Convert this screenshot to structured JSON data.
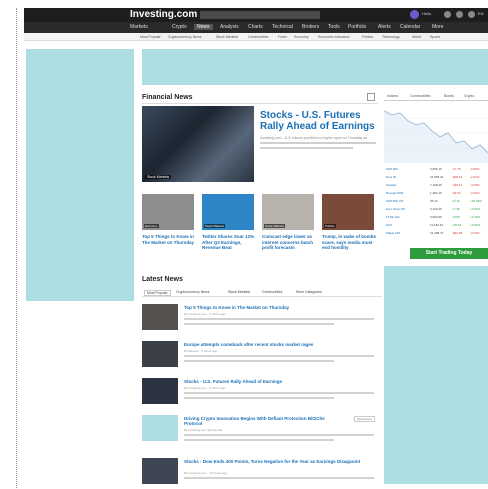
{
  "header": {
    "logo": "Investing.com",
    "search_placeholder": "Search the website...",
    "user_label": "Hello",
    "language": "EN"
  },
  "nav": {
    "items": [
      "Markets",
      "Crypto",
      "News",
      "Analysis",
      "Charts",
      "Technical",
      "Brokers",
      "Tools",
      "Portfolio",
      "Alerts",
      "Calendar",
      "More"
    ]
  },
  "subnav": {
    "items": [
      "Most Popular",
      "Cryptocurrency News",
      "Stock Markets",
      "Commodities",
      "Forex",
      "Economy",
      "Economic Indicators",
      "Politics",
      "Technology",
      "World",
      "Sports"
    ]
  },
  "financial_news": {
    "title": "Financial News",
    "main_story": {
      "tag": "Stock Markets",
      "headline": "Stocks - U.S. Futures Rally Ahead of Earnings",
      "meta": "Investing.com - U.S. futures pointed to a higher open on Thursday as…"
    },
    "thumbs": [
      {
        "tag": "Economy",
        "caption": "Top 5 Things to Know in The Market on Thursday",
        "color": "#8d8d8d"
      },
      {
        "tag": "Stock Markets",
        "caption": "Twitter Shares Soar 12% After Q3 Earnings, Revenue Beat",
        "color": "#2f86c6"
      },
      {
        "tag": "Stock Markets",
        "caption": "Comcast edge lower as internet concerns batch profit forecasts",
        "color": "#b7b2ab"
      },
      {
        "tag": "Politics",
        "caption": "Trump, in wake of bombs scare, says media must end hostility",
        "color": "#7a4a3a"
      }
    ]
  },
  "latest_news": {
    "title": "Latest News",
    "tabs": [
      "Most Popular",
      "Cryptocurrency News",
      "Stock Markets",
      "Commodities",
      "More Categories"
    ],
    "items": [
      {
        "title": "Top 5 Things to Know in The Market on Thursday",
        "meta": "By Investing.com · 5 hours ago",
        "sponsored": ""
      },
      {
        "title": "Europe attempts comeback after recent stocks market rages",
        "meta": "By Reuters · 5 hours ago",
        "sponsored": ""
      },
      {
        "title": "Stocks - U.S. Futures Rally Ahead of Earnings",
        "meta": "By Investing.com · 6 hours ago",
        "sponsored": ""
      },
      {
        "title": "Driving Crypto Innovation Begins With Defiant Protection Bit2Chs Protocol",
        "meta": "By Investing.com Sponsored",
        "sponsored": "Sponsored"
      },
      {
        "title": "Stocks - Dow Ends 400 Points, Turns Negative for the Year as Earnings Disappoint",
        "meta": "By Investing.com · 16 hours ago",
        "sponsored": ""
      }
    ]
  },
  "right_panel": {
    "tabs": [
      "Indices",
      "Commodities",
      "Bonds",
      "Crypto"
    ],
    "rows": [
      {
        "name": "S&P 500",
        "last": "2,656.10",
        "chg": "-17.76",
        "pct": "-0.66%",
        "color": "#d0312d"
      },
      {
        "name": "Dow 30",
        "last": "24,583.42",
        "chg": "-608.01",
        "pct": "-2.41%",
        "color": "#d0312d"
      },
      {
        "name": "Nasdaq",
        "last": "7,108.40",
        "chg": "-329.14",
        "pct": "-4.43%",
        "color": "#d0312d"
      },
      {
        "name": "Russell 2000",
        "last": "1,484.16",
        "chg": "-52.63",
        "pct": "-3.42%",
        "color": "#d0312d"
      },
      {
        "name": "S&P 500 VIX",
        "last": "25.23",
        "chg": "+5.10",
        "pct": "+25.33%",
        "color": "#2e9b3d"
      },
      {
        "name": "Euro Stoxx 50",
        "last": "3,100.26",
        "chg": "+7.38",
        "pct": "+0.24%",
        "color": "#2e9b3d"
      },
      {
        "name": "FTSE 100",
        "last": "6,963.69",
        "chg": "+8.50",
        "pct": "+0.12%",
        "color": "#2e9b3d"
      },
      {
        "name": "DAX",
        "last": "11,184.64",
        "chg": "+35.64",
        "pct": "+0.32%",
        "color": "#2e9b3d"
      },
      {
        "name": "Nikkei 225",
        "last": "21,268.73",
        "chg": "-822.45",
        "pct": "-3.72%",
        "color": "#d0312d"
      }
    ],
    "trade_button": "Start Trading Today"
  },
  "colors": {
    "ad": "#acdde0",
    "link": "#1a6fb5",
    "up": "#2e9b3d",
    "down": "#d0312d"
  }
}
